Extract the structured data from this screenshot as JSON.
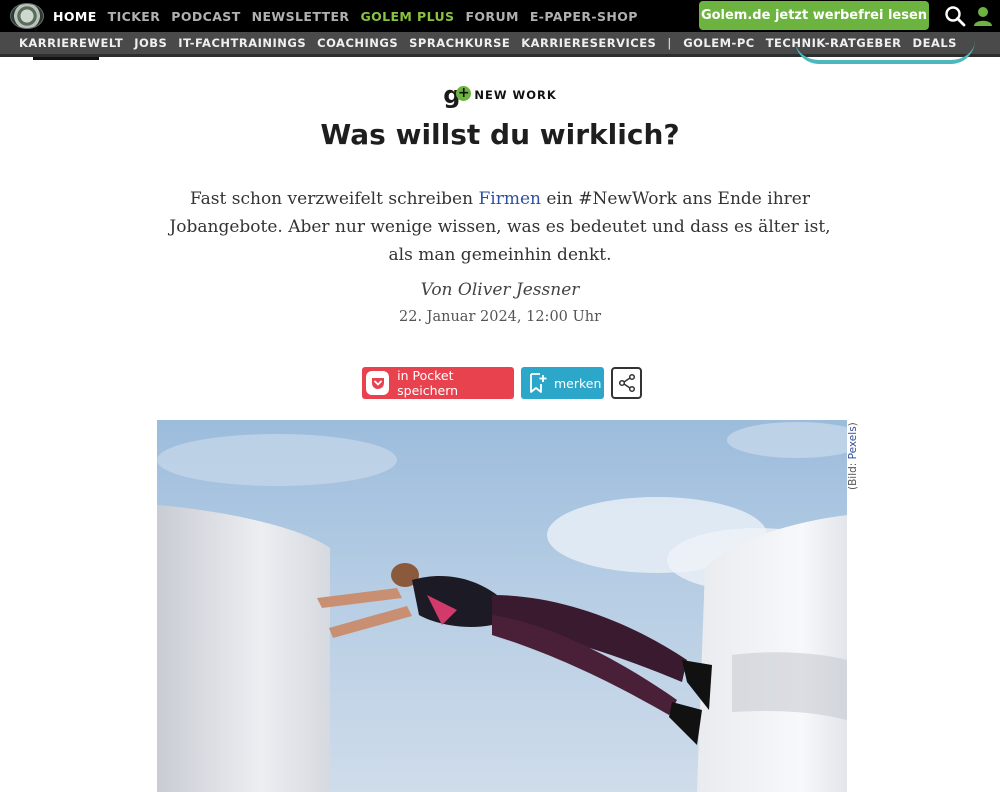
{
  "topnav": {
    "items": [
      {
        "label": "HOME",
        "state": "active"
      },
      {
        "label": "TICKER"
      },
      {
        "label": "PODCAST"
      },
      {
        "label": "NEWSLETTER"
      },
      {
        "label": "GOLEM PLUS",
        "state": "highlight"
      },
      {
        "label": "FORUM"
      },
      {
        "label": "E-PAPER-SHOP"
      }
    ],
    "cta_label": "Golem.de jetzt werbefrei lesen"
  },
  "subnav": {
    "items": [
      "KARRIEREWELT",
      "JOBS",
      "IT-FACHTRAININGS",
      "COACHINGS",
      "SPRACHKURSE",
      "KARRIERESERVICES"
    ],
    "separator": "|",
    "items_after": [
      "GOLEM-PC",
      "TECHNIK-RATGEBER",
      "DEALS"
    ]
  },
  "article": {
    "kicker_logo": "g",
    "kicker": "NEW WORK",
    "headline": "Was willst du wirklich?",
    "teaser_before": "Fast schon verzweifelt schreiben ",
    "teaser_link": "Firmen",
    "teaser_after": " ein #NewWork ans Ende ihrer Jobangebote. Aber nur wenige wissen, was es bedeutet und dass es älter ist, als man gemeinhin denkt.",
    "author": "Von Oliver Jessner",
    "date": "22. Januar 2024, 12:00 Uhr"
  },
  "actions": {
    "pocket_label": "in Pocket speichern",
    "merken_label": "merken"
  },
  "image": {
    "credit_prefix": "(Bild: ",
    "credit_source": "Pexels",
    "credit_suffix": ")"
  },
  "colors": {
    "accent_green": "#6cb33f",
    "pocket_red": "#e8424f",
    "merken_blue": "#2da7c9",
    "link_blue": "#2f4f9e"
  }
}
